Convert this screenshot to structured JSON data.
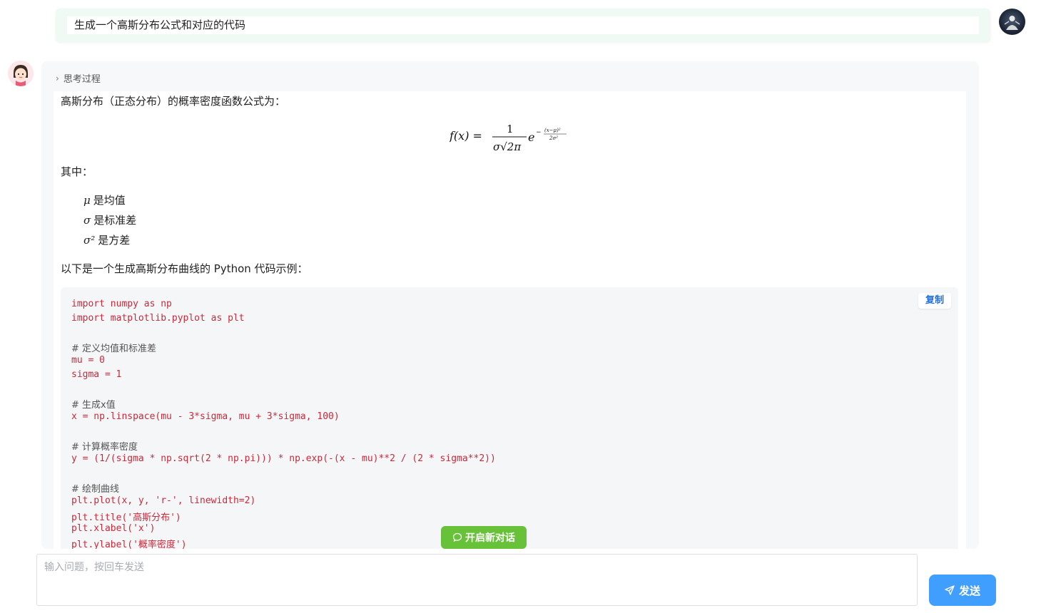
{
  "user": {
    "question": "生成一个高斯分布公式和对应的代码"
  },
  "assistant": {
    "thinking_label": "思考过程",
    "intro": "高斯分布（正态分布）的概率密度函数公式为：",
    "formula": {
      "lhs": "f(x) =",
      "numerator": "1",
      "denominator": "σ√2π",
      "base": "e",
      "exponent_num": "(x−μ)²",
      "exponent_den": "2σ²"
    },
    "where_label": "其中：",
    "definitions": [
      {
        "symbol": "μ",
        "text": "是均值"
      },
      {
        "symbol": "σ",
        "text": "是标准差"
      },
      {
        "symbol": "σ²",
        "text": "是方差"
      }
    ],
    "code_intro": "以下是一个生成高斯分布曲线的 Python 代码示例：",
    "copy_label": "复制",
    "code_lines": [
      "import numpy as np",
      "import matplotlib.pyplot as plt",
      "",
      "# 定义均值和标准差",
      "mu = 0",
      "sigma = 1",
      "",
      "# 生成x值",
      "x = np.linspace(mu - 3*sigma, mu + 3*sigma, 100)",
      "",
      "# 计算概率密度",
      "y = (1/(sigma * np.sqrt(2 * np.pi))) * np.exp(-(x - mu)**2 / (2 * sigma**2))",
      "",
      "# 绘制曲线",
      "plt.plot(x, y, 'r-', linewidth=2)",
      "plt.title('高斯分布')",
      "plt.xlabel('x')",
      "plt.ylabel('概率密度')"
    ]
  },
  "new_chat_label": "开启新对话",
  "input": {
    "placeholder": "输入问题，按回车发送"
  },
  "send_label": "发送",
  "colors": {
    "send": "#409eff",
    "new_chat": "#67c23a",
    "user_bubble": "#eefaf3",
    "code_keyword": "#c92a3a",
    "code_number": "#1a5fb4"
  }
}
